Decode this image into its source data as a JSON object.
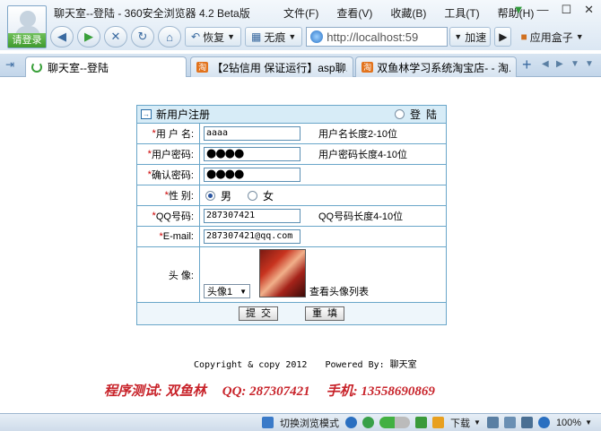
{
  "browser": {
    "window_title": "聊天室--登陆 - 360安全浏览器 4.2 Beta版",
    "login_badge": "请登录",
    "menu": [
      "文件(F)",
      "查看(V)",
      "收藏(B)",
      "工具(T)",
      "帮助(H)"
    ],
    "nav": {
      "restore_label": "恢复",
      "incognito_label": "无痕",
      "address": "http://localhost:59",
      "accelerate_label": "加速",
      "appbox_label": "应用盒子"
    },
    "tabs": [
      {
        "title": "聊天室--登陆",
        "active": true
      },
      {
        "title": "【2钻信用 保证运行】asp聊...",
        "active": false
      },
      {
        "title": "双鱼林学习系统淘宝店- - 淘...",
        "active": false
      }
    ]
  },
  "form": {
    "header_title": "新用户注册",
    "login_link": "登陆",
    "fields": {
      "username": {
        "label": "用 户 名:",
        "value": "aaaa",
        "hint": "用户名长度2-10位"
      },
      "password": {
        "label": "用户密码:",
        "value": "●●●●",
        "hint": "用户密码长度4-10位"
      },
      "confirm": {
        "label": "确认密码:",
        "value": "●●●●"
      },
      "gender": {
        "label": "性 别:",
        "male": "男",
        "female": "女",
        "selected": "男"
      },
      "qq": {
        "label": "QQ号码:",
        "value": "287307421",
        "hint": "QQ号码长度4-10位"
      },
      "email": {
        "label": "E-mail:",
        "value": "287307421@qq.com"
      },
      "avatar": {
        "label": "头 像:",
        "selected": "头像1",
        "view_list": "查看头像列表"
      }
    },
    "required_mark": "*",
    "submit_label": "提交",
    "reset_label": "重填"
  },
  "footer": {
    "copyright": "Copyright & copy 2012",
    "powered": "Powered By: 聊天室",
    "tester": "程序测试: 双鱼林",
    "qq": "QQ: 287307421",
    "phone": "手机: 13558690869"
  },
  "status": {
    "mode_label": "切换浏览模式",
    "download_label": "下载",
    "zoom": "100%"
  }
}
